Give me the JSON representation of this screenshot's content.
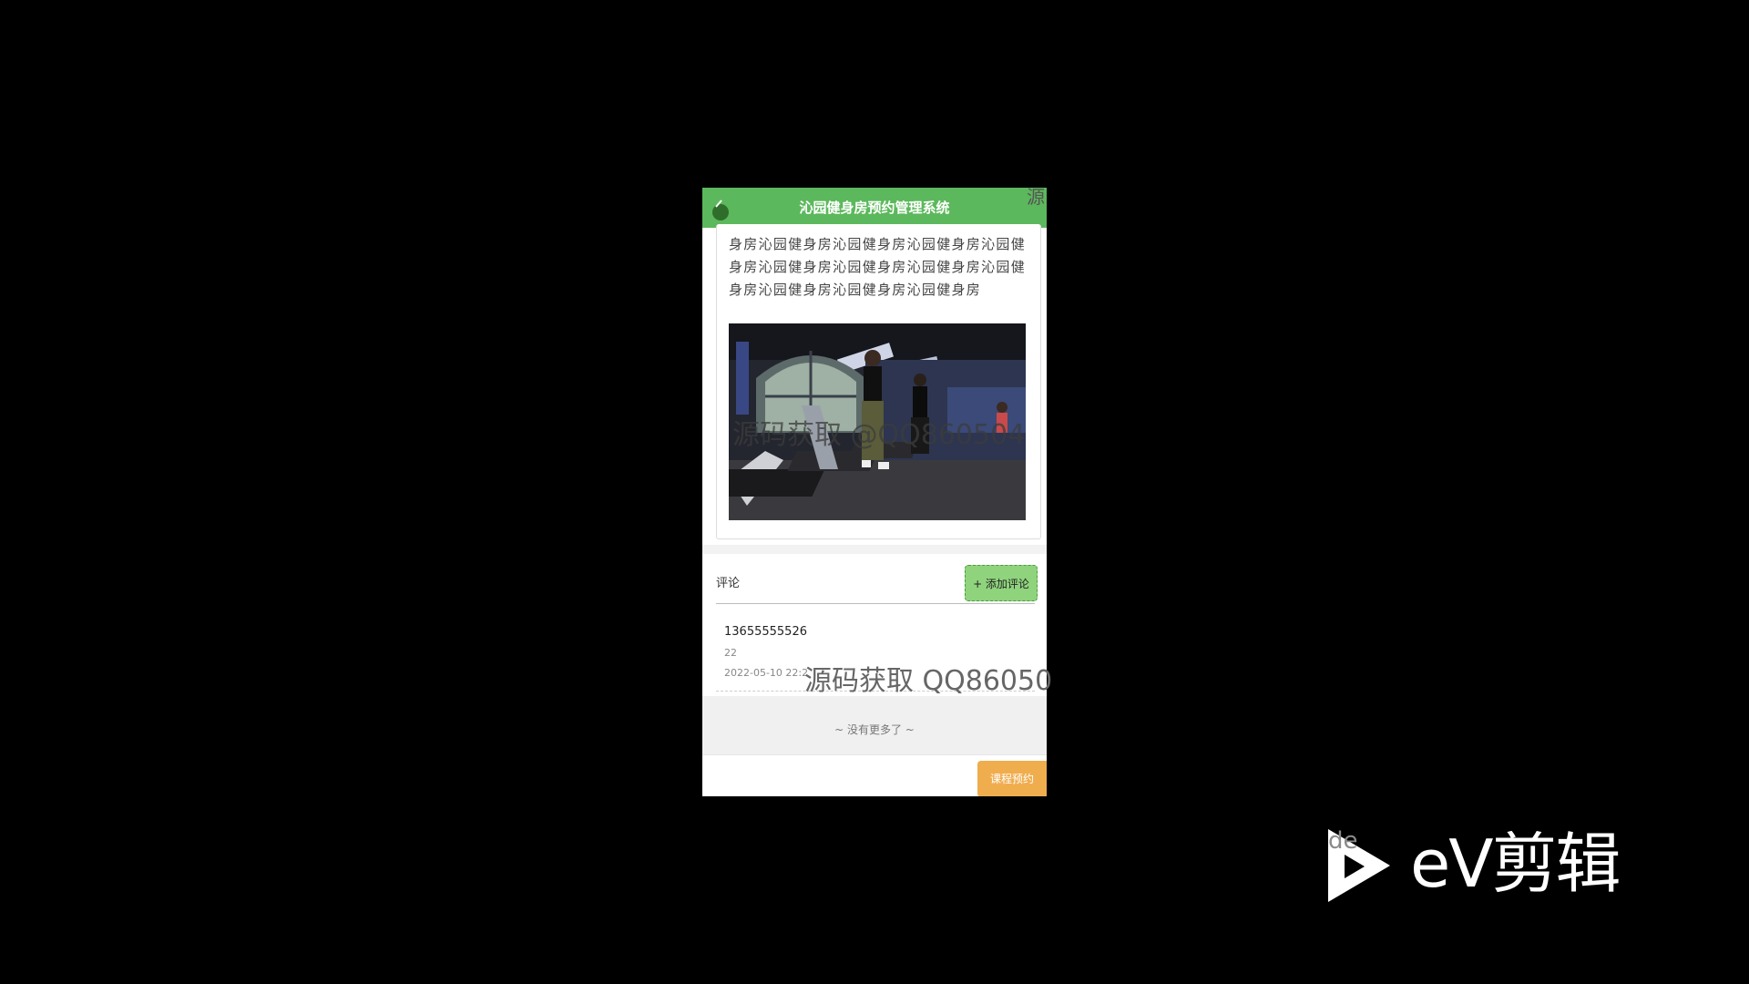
{
  "header": {
    "title": "沁园健身房预约管理系统",
    "corner_text": "源"
  },
  "content": {
    "description": "身房沁园健身房沁园健身房沁园健身房沁园健身房沁园健身房沁园健身房沁园健身房沁园健身房沁园健身房沁园健身房沁园健身房",
    "photo_alt": "treadmill gym photo"
  },
  "comments": {
    "label": "评论",
    "add_button": "+ 添加评论",
    "items": [
      {
        "user": "13655555526",
        "text": "22",
        "time": "2022-05-10 22:2"
      }
    ],
    "no_more": "~ 没有更多了 ~"
  },
  "footer": {
    "book_button": "课程预约"
  },
  "watermarks": {
    "overlay_1": "源码获取 @QQ860504",
    "overlay_2": "源码获取 QQ86050"
  },
  "branding": {
    "logo_text": "eV剪辑",
    "faint_text": "de"
  },
  "colors": {
    "header_green": "#5cb85c",
    "add_button": "#8fd47d",
    "book_button": "#f0ad4e"
  }
}
